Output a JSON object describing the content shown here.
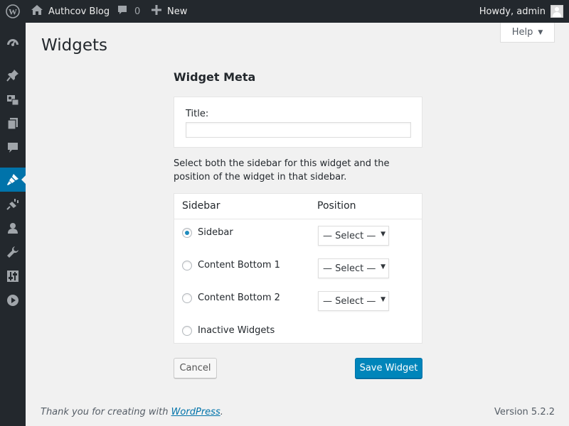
{
  "adminbar": {
    "site_name": "Authcov Blog",
    "comment_count": "0",
    "new_label": "New",
    "greeting": "Howdy, admin",
    "background": "#23282d"
  },
  "sidebar": {
    "items": [
      {
        "icon": "dashboard-icon"
      },
      {
        "icon": "pin-icon"
      },
      {
        "icon": "media-icon"
      },
      {
        "icon": "pages-icon"
      },
      {
        "icon": "comments-icon"
      },
      {
        "icon": "appearance-icon",
        "active": true
      },
      {
        "icon": "plugins-icon"
      },
      {
        "icon": "users-icon"
      },
      {
        "icon": "tools-icon"
      },
      {
        "icon": "settings-icon"
      },
      {
        "icon": "play-icon"
      }
    ],
    "active_color": "#0073aa"
  },
  "help_tab": {
    "label": "Help"
  },
  "page": {
    "title": "Widgets",
    "section_title": "Widget Meta",
    "title_field_label": "Title:",
    "title_field_value": "",
    "instructions": "Select both the sidebar for this widget and the position of the widget in that sidebar."
  },
  "table": {
    "headers": {
      "sidebar": "Sidebar",
      "position": "Position"
    },
    "rows": [
      {
        "label": "Sidebar",
        "checked": true,
        "select": "— Select —"
      },
      {
        "label": "Content Bottom 1",
        "checked": false,
        "select": "— Select —"
      },
      {
        "label": "Content Bottom 2",
        "checked": false,
        "select": "— Select —"
      },
      {
        "label": "Inactive Widgets",
        "checked": false,
        "select": null
      }
    ]
  },
  "actions": {
    "cancel_label": "Cancel",
    "save_label": "Save Widget",
    "primary_color": "#0085ba"
  },
  "footer": {
    "thanks_prefix": "Thank you for creating with ",
    "thanks_link": "WordPress",
    "thanks_suffix": ".",
    "version": "Version 5.2.2"
  }
}
